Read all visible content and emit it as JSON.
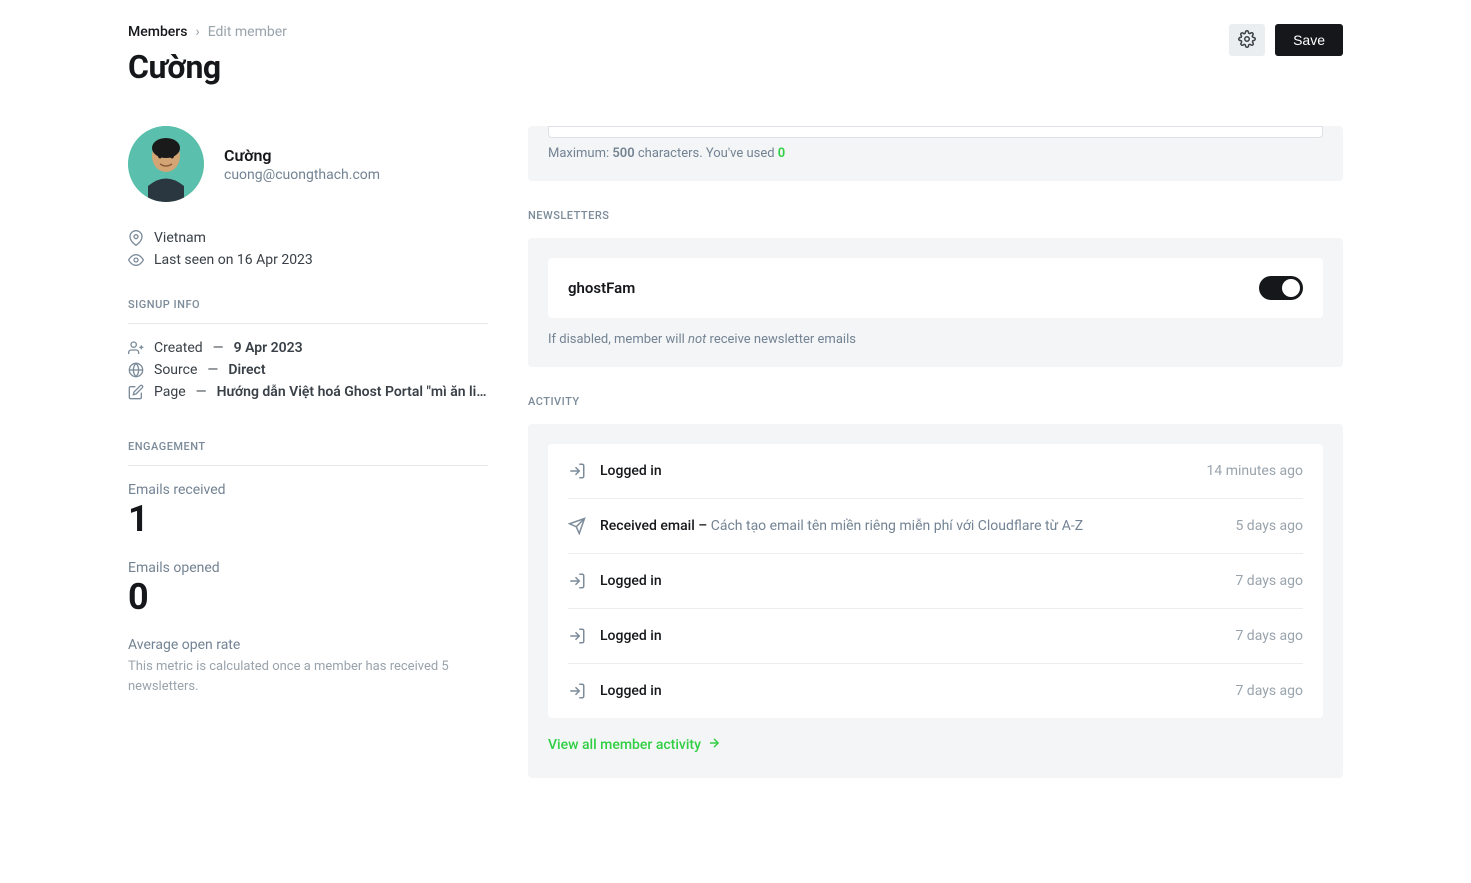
{
  "breadcrumb": {
    "root": "Members",
    "current": "Edit member"
  },
  "page_title": "Cường",
  "actions": {
    "save_label": "Save"
  },
  "profile": {
    "name": "Cường",
    "email": "cuong@cuongthach.com",
    "location": "Vietnam",
    "last_seen": "Last seen on 16 Apr 2023"
  },
  "signup": {
    "heading": "SIGNUP INFO",
    "created_label": "Created",
    "created_value": "9 Apr 2023",
    "source_label": "Source",
    "source_value": "Direct",
    "page_label": "Page",
    "page_value": "Hướng dẫn Việt hoá Ghost Portal \"mì ăn li..."
  },
  "engagement": {
    "heading": "ENGAGEMENT",
    "emails_received_label": "Emails received",
    "emails_received_value": "1",
    "emails_opened_label": "Emails opened",
    "emails_opened_value": "0",
    "open_rate_label": "Average open rate",
    "open_rate_note": "This metric is calculated once a member has received 5 newsletters."
  },
  "note": {
    "max_prefix": "Maximum: ",
    "max_value": "500",
    "max_suffix": " characters. You've used ",
    "used": "0"
  },
  "newsletters": {
    "heading": "NEWSLETTERS",
    "name": "ghostFam",
    "note_prefix": "If disabled, member will ",
    "note_em": "not",
    "note_suffix": " receive newsletter emails"
  },
  "activity": {
    "heading": "ACTIVITY",
    "items": [
      {
        "icon": "login",
        "action": "Logged in",
        "detail": "",
        "time": "14 minutes ago"
      },
      {
        "icon": "email",
        "action": "Received email – ",
        "detail": "Cách tạo email tên miền riêng miễn phí với Cloudflare từ A-Z",
        "time": "5 days ago"
      },
      {
        "icon": "login",
        "action": "Logged in",
        "detail": "",
        "time": "7 days ago"
      },
      {
        "icon": "login",
        "action": "Logged in",
        "detail": "",
        "time": "7 days ago"
      },
      {
        "icon": "login",
        "action": "Logged in",
        "detail": "",
        "time": "7 days ago"
      }
    ],
    "view_all": "View all member activity"
  }
}
